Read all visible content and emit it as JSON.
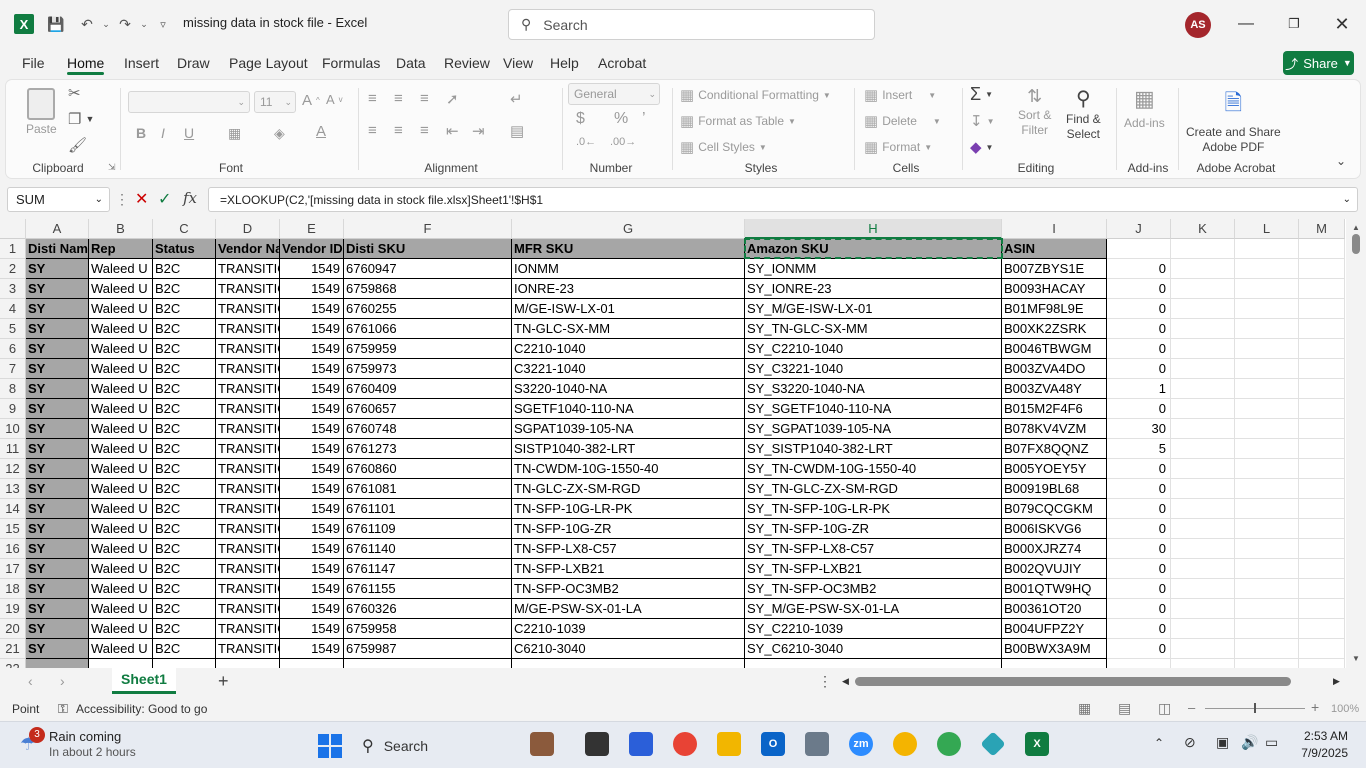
{
  "window": {
    "doc_title": "missing data in stock file  -  Excel",
    "search_placeholder": "Search",
    "avatar_initials": "AS"
  },
  "menu": [
    "File",
    "Home",
    "Insert",
    "Draw",
    "Page Layout",
    "Formulas",
    "Data",
    "Review",
    "View",
    "Help",
    "Acrobat"
  ],
  "share_label": "Share",
  "ribbon": {
    "clipboard": {
      "paste": "Paste",
      "label": "Clipboard"
    },
    "font": {
      "size": "11",
      "label": "Font"
    },
    "alignment": {
      "label": "Alignment"
    },
    "number": {
      "format": "General",
      "label": "Number"
    },
    "styles": {
      "conditional": "Conditional Formatting",
      "table": "Format as Table",
      "cell": "Cell Styles",
      "label": "Styles"
    },
    "cells": {
      "insert": "Insert",
      "delete": "Delete",
      "format": "Format",
      "label": "Cells"
    },
    "editing": {
      "sort1": "Sort &",
      "sort2": "Filter",
      "find1": "Find &",
      "find2": "Select",
      "label": "Editing"
    },
    "addins": {
      "btn": "Add-ins",
      "label": "Add-ins"
    },
    "acrobat": {
      "btn1": "Create and Share",
      "btn2": "Adobe PDF",
      "label": "Adobe Acrobat"
    }
  },
  "formula_bar": {
    "name_box": "SUM",
    "formula": "=XLOOKUP(C2,'[missing data in stock file.xlsx]Sheet1'!$H$1"
  },
  "columns": [
    "A",
    "B",
    "C",
    "D",
    "E",
    "F",
    "G",
    "H",
    "I",
    "J",
    "K",
    "L",
    "M"
  ],
  "headers": [
    "Disti Name",
    "Rep",
    "Status",
    "Vendor Name",
    "Vendor ID",
    "Disti SKU",
    "MFR SKU",
    "Amazon SKU",
    "ASIN"
  ],
  "rows": [
    [
      "SY",
      "Waleed U",
      "B2C",
      "TRANSITION",
      "1549",
      "6760947",
      "IONMM",
      "SY_IONMM",
      "B007ZBYS1E",
      "0"
    ],
    [
      "SY",
      "Waleed U",
      "B2C",
      "TRANSITION",
      "1549",
      "6759868",
      "IONRE-23",
      "SY_IONRE-23",
      "B0093HACAY",
      "0"
    ],
    [
      "SY",
      "Waleed U",
      "B2C",
      "TRANSITION",
      "1549",
      "6760255",
      "M/GE-ISW-LX-01",
      "SY_M/GE-ISW-LX-01",
      "B01MF98L9E",
      "0"
    ],
    [
      "SY",
      "Waleed U",
      "B2C",
      "TRANSITION",
      "1549",
      "6761066",
      "TN-GLC-SX-MM",
      "SY_TN-GLC-SX-MM",
      "B00XK2ZSRK",
      "0"
    ],
    [
      "SY",
      "Waleed U",
      "B2C",
      "TRANSITION",
      "1549",
      "6759959",
      "C2210-1040",
      "SY_C2210-1040",
      "B0046TBWGM",
      "0"
    ],
    [
      "SY",
      "Waleed U",
      "B2C",
      "TRANSITION",
      "1549",
      "6759973",
      "C3221-1040",
      "SY_C3221-1040",
      "B003ZVA4DO",
      "0"
    ],
    [
      "SY",
      "Waleed U",
      "B2C",
      "TRANSITION",
      "1549",
      "6760409",
      "S3220-1040-NA",
      "SY_S3220-1040-NA",
      "B003ZVA48Y",
      "1"
    ],
    [
      "SY",
      "Waleed U",
      "B2C",
      "TRANSITION",
      "1549",
      "6760657",
      "SGETF1040-110-NA",
      "SY_SGETF1040-110-NA",
      "B015M2F4F6",
      "0"
    ],
    [
      "SY",
      "Waleed U",
      "B2C",
      "TRANSITION",
      "1549",
      "6760748",
      "SGPAT1039-105-NA",
      "SY_SGPAT1039-105-NA",
      "B078KV4VZM",
      "30"
    ],
    [
      "SY",
      "Waleed U",
      "B2C",
      "TRANSITION",
      "1549",
      "6761273",
      "SISTP1040-382-LRT",
      "SY_SISTP1040-382-LRT",
      "B07FX8QQNZ",
      "5"
    ],
    [
      "SY",
      "Waleed U",
      "B2C",
      "TRANSITION",
      "1549",
      "6760860",
      "TN-CWDM-10G-1550-40",
      "SY_TN-CWDM-10G-1550-40",
      "B005YOEY5Y",
      "0"
    ],
    [
      "SY",
      "Waleed U",
      "B2C",
      "TRANSITION",
      "1549",
      "6761081",
      "TN-GLC-ZX-SM-RGD",
      "SY_TN-GLC-ZX-SM-RGD",
      "B00919BL68",
      "0"
    ],
    [
      "SY",
      "Waleed U",
      "B2C",
      "TRANSITION",
      "1549",
      "6761101",
      "TN-SFP-10G-LR-PK",
      "SY_TN-SFP-10G-LR-PK",
      "B079CQCGKM",
      "0"
    ],
    [
      "SY",
      "Waleed U",
      "B2C",
      "TRANSITION",
      "1549",
      "6761109",
      "TN-SFP-10G-ZR",
      "SY_TN-SFP-10G-ZR",
      "B006ISKVG6",
      "0"
    ],
    [
      "SY",
      "Waleed U",
      "B2C",
      "TRANSITION",
      "1549",
      "6761140",
      "TN-SFP-LX8-C57",
      "SY_TN-SFP-LX8-C57",
      "B000XJRZ74",
      "0"
    ],
    [
      "SY",
      "Waleed U",
      "B2C",
      "TRANSITION",
      "1549",
      "6761147",
      "TN-SFP-LXB21",
      "SY_TN-SFP-LXB21",
      "B002QVUJIY",
      "0"
    ],
    [
      "SY",
      "Waleed U",
      "B2C",
      "TRANSITION",
      "1549",
      "6761155",
      "TN-SFP-OC3MB2",
      "SY_TN-SFP-OC3MB2",
      "B001QTW9HQ",
      "0"
    ],
    [
      "SY",
      "Waleed U",
      "B2C",
      "TRANSITION",
      "1549",
      "6760326",
      "M/GE-PSW-SX-01-LA",
      "SY_M/GE-PSW-SX-01-LA",
      "B00361OT20",
      "0"
    ],
    [
      "SY",
      "Waleed U",
      "B2C",
      "TRANSITION",
      "1549",
      "6759958",
      "C2210-1039",
      "SY_C2210-1039",
      "B004UFPZ2Y",
      "0"
    ],
    [
      "SY",
      "Waleed U",
      "B2C",
      "TRANSITION",
      "1549",
      "6759987",
      "C6210-3040",
      "SY_C6210-3040",
      "B00BWX3A9M",
      "0"
    ]
  ],
  "sheet": {
    "tab": "Sheet1"
  },
  "status": {
    "mode": "Point",
    "accessibility": "Accessibility: Good to go",
    "zoom": "100%"
  },
  "taskbar": {
    "weather_title": "Rain coming",
    "weather_sub": "In about 2 hours",
    "weather_badge": "3",
    "search": "Search",
    "time": "2:53 AM",
    "date": "7/9/2025"
  }
}
